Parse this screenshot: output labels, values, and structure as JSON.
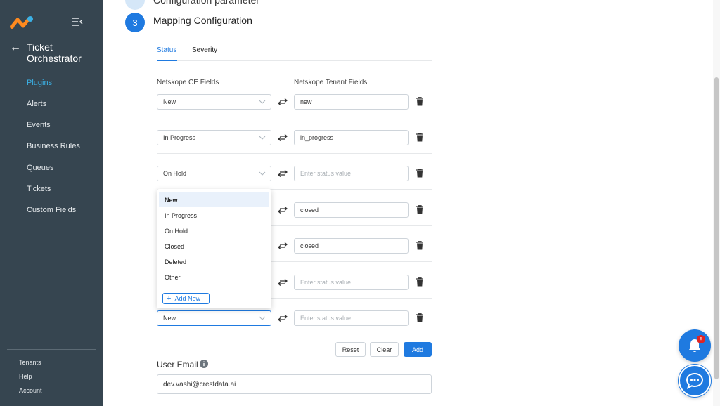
{
  "sidebar": {
    "module_title": "Ticket Orchestrator",
    "nav": [
      {
        "label": "Plugins",
        "active": true
      },
      {
        "label": "Alerts"
      },
      {
        "label": "Events"
      },
      {
        "label": "Business Rules"
      },
      {
        "label": "Queues"
      },
      {
        "label": "Tickets"
      },
      {
        "label": "Custom Fields"
      }
    ],
    "footer": [
      {
        "label": "Tenants"
      },
      {
        "label": "Help"
      },
      {
        "label": "Account"
      }
    ]
  },
  "stepper": {
    "previous_label": "Configuration parameter",
    "current_number": "3",
    "current_title": "Mapping Configuration"
  },
  "tabs": [
    {
      "label": "Status",
      "active": true
    },
    {
      "label": "Severity"
    }
  ],
  "mapping": {
    "left_header": "Netskope CE Fields",
    "right_header": "Netskope Tenant Fields",
    "placeholder": "Enter status value",
    "rows": [
      {
        "ce_field": "New",
        "tenant_field": "new"
      },
      {
        "ce_field": "In Progress",
        "tenant_field": "in_progress"
      },
      {
        "ce_field": "On Hold",
        "tenant_field": ""
      },
      {
        "ce_field": "Closed",
        "tenant_field": "closed"
      },
      {
        "ce_field": "Deleted",
        "tenant_field": "closed"
      },
      {
        "ce_field": "Other",
        "tenant_field": ""
      },
      {
        "ce_field": "New",
        "tenant_field": ""
      }
    ]
  },
  "dropdown": {
    "options": [
      "New",
      "In Progress",
      "On Hold",
      "Closed",
      "Deleted",
      "Other"
    ],
    "selected": "New",
    "add_new_label": "Add New"
  },
  "buttons": {
    "reset": "Reset",
    "clear": "Clear",
    "add": "Add"
  },
  "user_email": {
    "label": "User Email",
    "value": "dev.vashi@crestdata.ai"
  },
  "notifications": {
    "badge": "!"
  },
  "colors": {
    "sidebar_bg": "#364550",
    "accent": "#1f7ae0",
    "active_nav": "#3bb1e6",
    "badge": "#e02424"
  }
}
